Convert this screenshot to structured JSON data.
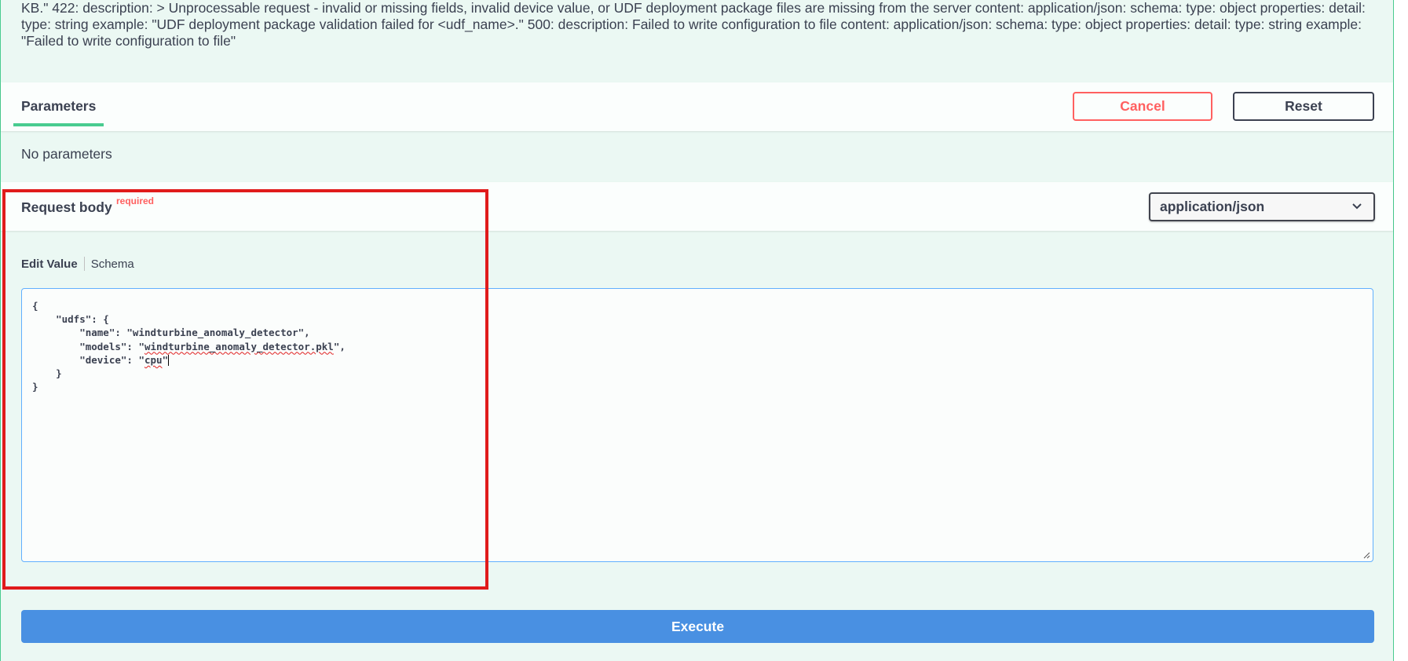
{
  "description": {
    "text": "KB.\" 422: description: > Unprocessable request - invalid or missing fields, invalid device value, or UDF deployment package files are missing from the server content: application/json: schema: type: object properties: detail: type: string example: \"UDF deployment package validation failed for <udf_name>.\" 500: description: Failed to write configuration to file content: application/json: schema: type: object properties: detail: type: string example: \"Failed to write configuration to file\""
  },
  "parameters": {
    "tab_label": "Parameters",
    "cancel_label": "Cancel",
    "reset_label": "Reset",
    "empty_text": "No parameters"
  },
  "request_body": {
    "title": "Request body",
    "required_label": "required",
    "content_type": "application/json",
    "edit_value_tab": "Edit Value",
    "schema_tab": "Schema"
  },
  "editor": {
    "line1": "{",
    "line2_pre": "    \"udfs\": {",
    "line3_pre": "        \"name\": \"windturbine_anomaly_detector\",",
    "line4_prefix": "        \"models\": \"",
    "line4_word": "windturbine_anomaly_detector.pkl",
    "line4_suffix": "\",",
    "line5_prefix": "        \"device\": \"",
    "line5_word": "cpu",
    "line5_suffix": "\"",
    "line6": "    }",
    "line7": "}"
  },
  "execute_label": "Execute",
  "colors": {
    "accent_green": "#49cc90",
    "cancel_red": "#ff6060",
    "execute_blue": "#4990e2",
    "highlight_red": "#e01b1b"
  }
}
